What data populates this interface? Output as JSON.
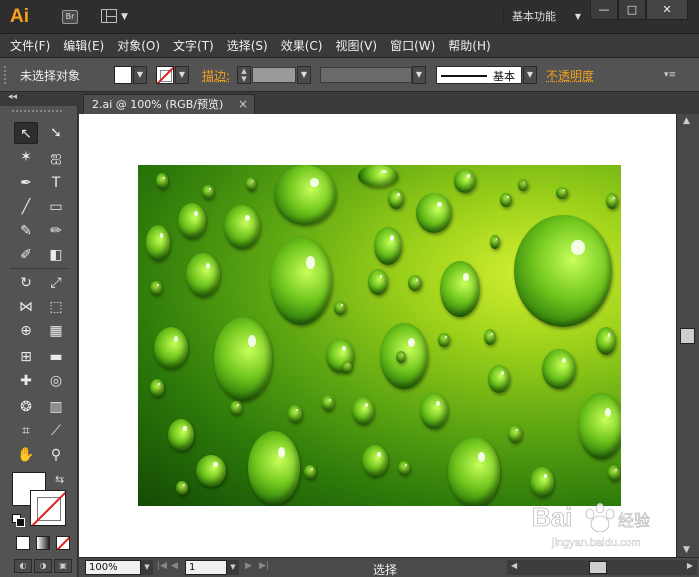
{
  "app": {
    "logo_text": "Ai",
    "bridge_label": "Br",
    "workspace_label": "基本功能",
    "window_buttons": [
      "—",
      "□",
      "✕"
    ]
  },
  "menu": {
    "items": [
      "文件(F)",
      "编辑(E)",
      "对象(O)",
      "文字(T)",
      "选择(S)",
      "效果(C)",
      "视图(V)",
      "窗口(W)",
      "帮助(H)"
    ]
  },
  "control": {
    "selection_label": "未选择对象",
    "stroke_label": "描边:",
    "brush_label": "基本",
    "opacity_label": "不透明度",
    "accent_color": "#f4a01c"
  },
  "document": {
    "tab_title": "2.ai @ 100% (RGB/预览)",
    "close_glyph": "×"
  },
  "statusbar": {
    "zoom": "100%",
    "page": "1",
    "status": "选择"
  },
  "watermark": {
    "text": "Baidu经验",
    "subtext": "jingyan.baidu.com"
  }
}
